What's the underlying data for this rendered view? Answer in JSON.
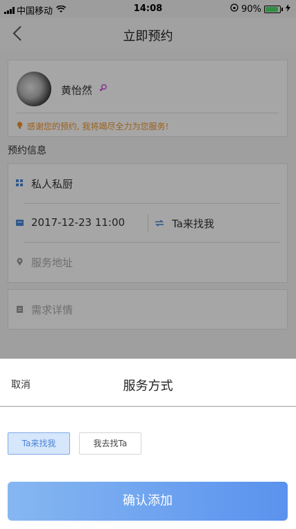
{
  "status_bar": {
    "carrier": "中国移动",
    "time": "14:08",
    "battery_text": "90%",
    "battery_level": 0.9,
    "battery_color": "#4cd964"
  },
  "nav": {
    "back_icon": "chevron-left-icon",
    "title": "立即预约"
  },
  "profile": {
    "name": "黄怡然",
    "gender_icon": "female-icon",
    "gender_color": "#d03ad8",
    "thanks_message": "感谢您的预约, 我将竭尽全力为您服务!",
    "thanks_color": "#f0942c"
  },
  "booking": {
    "section_title": "预约信息",
    "service": "私人私厨",
    "datetime": "2017-12-23 11:00",
    "service_mode": "Ta来找我",
    "address_placeholder": "服务地址",
    "details_placeholder": "需求详情"
  },
  "sheet": {
    "cancel_label": "取消",
    "title": "服务方式",
    "options": [
      {
        "label": "Ta来找我",
        "selected": true
      },
      {
        "label": "我去找Ta",
        "selected": false
      }
    ],
    "confirm_label": "确认添加",
    "accent_color": "#5a92ee"
  }
}
